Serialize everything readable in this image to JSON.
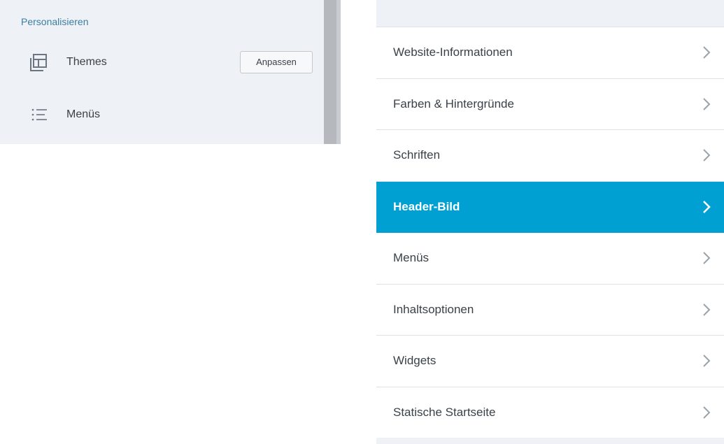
{
  "left_panel": {
    "section_heading": "Personalisieren",
    "items": [
      {
        "label": "Themes",
        "icon": "themes-icon",
        "button_label": "Anpassen"
      },
      {
        "label": "Menüs",
        "icon": "menu-list-icon"
      }
    ]
  },
  "right_panel": {
    "items": [
      {
        "label": "Website-Informationen",
        "active": false
      },
      {
        "label": "Farben & Hintergründe",
        "active": false
      },
      {
        "label": "Schriften",
        "active": false
      },
      {
        "label": "Header-Bild",
        "active": true
      },
      {
        "label": "Menüs",
        "active": false
      },
      {
        "label": "Inhaltsoptionen",
        "active": false
      },
      {
        "label": "Widgets",
        "active": false
      },
      {
        "label": "Statische Startseite",
        "active": false
      }
    ],
    "chevron_icon": "chevron-right-icon"
  },
  "colors": {
    "accent": "#00a0d2",
    "panel_bg": "#eef1f5",
    "heading": "#3c7ea3",
    "text": "#3a4148"
  }
}
